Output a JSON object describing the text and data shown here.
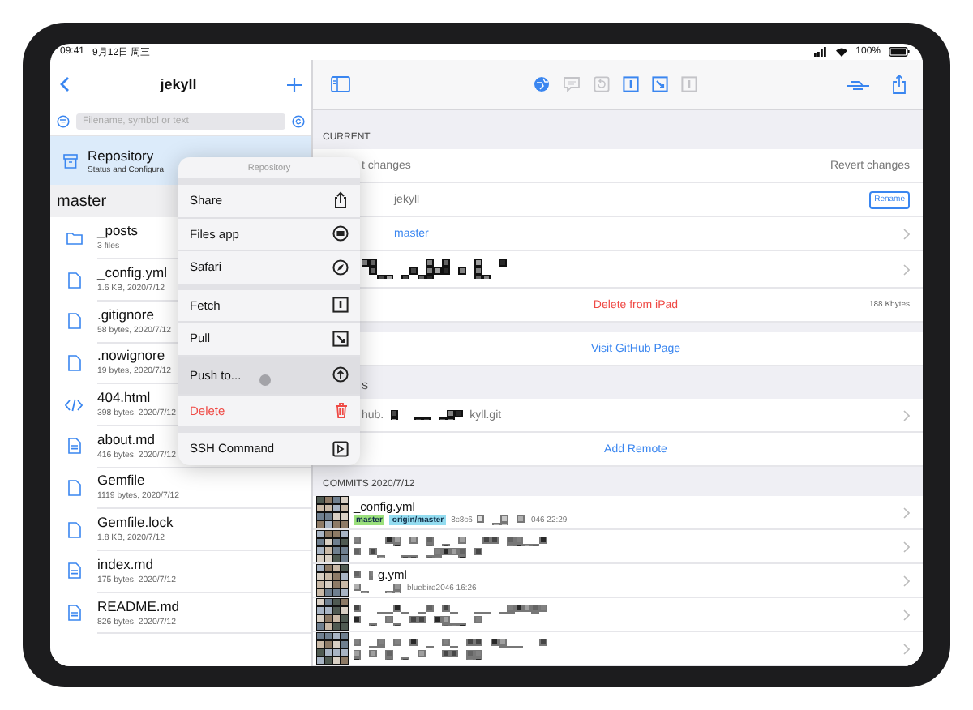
{
  "status_bar": {
    "time": "09:41",
    "date": "9月12日 周三",
    "battery": "100%"
  },
  "sidebar": {
    "title": "jekyll",
    "search": {
      "placeholder": "Filename, symbol or text"
    },
    "repository": {
      "title": "Repository",
      "subtitle": "Status and Configura",
      "selected": true
    },
    "branch": "master",
    "files": [
      {
        "name": "_posts",
        "detail": "3 files",
        "kind": "folder"
      },
      {
        "name": "_config.yml",
        "detail": "1.6 KB, 2020/7/12",
        "kind": "file"
      },
      {
        "name": ".gitignore",
        "detail": "58 bytes, 2020/7/12",
        "kind": "file"
      },
      {
        "name": ".nowignore",
        "detail": "19 bytes, 2020/7/12",
        "kind": "file"
      },
      {
        "name": "404.html",
        "detail": "398 bytes, 2020/7/12",
        "kind": "code"
      },
      {
        "name": "about.md",
        "detail": "416 bytes, 2020/7/12",
        "kind": "text"
      },
      {
        "name": "Gemfile",
        "detail": "1119 bytes, 2020/7/12",
        "kind": "file"
      },
      {
        "name": "Gemfile.lock",
        "detail": "1.8 KB, 2020/7/12",
        "kind": "file"
      },
      {
        "name": "index.md",
        "detail": "175 bytes, 2020/7/12",
        "kind": "text"
      },
      {
        "name": "README.md",
        "detail": "826 bytes, 2020/7/12",
        "kind": "text"
      }
    ]
  },
  "toolbar": {
    "buttons": [
      {
        "kind": "globe",
        "disabled": false
      },
      {
        "kind": "comment",
        "disabled": true
      },
      {
        "kind": "revert",
        "disabled": true
      },
      {
        "kind": "fetch",
        "disabled": false
      },
      {
        "kind": "pull",
        "disabled": false
      },
      {
        "kind": "push",
        "disabled": true
      }
    ]
  },
  "details": {
    "current_header": "CURRENT",
    "changes": "t changes",
    "revert": "Revert changes",
    "name": "jekyll",
    "rename": "Rename",
    "branch": "master",
    "delete": "Delete from iPad",
    "size": "188 Kbytes",
    "visit": "Visit GitHub Page",
    "remotes_header": "S",
    "remote_start": "hub.",
    "remote_end": "kyll.git",
    "add_remote": "Add Remote"
  },
  "commits": {
    "header": "COMMITS 2020/7/12",
    "rows": [
      {
        "title": "_config.yml",
        "tags": [
          {
            "label": "master",
            "color": "#9be07c"
          },
          {
            "label": "origin/master",
            "color": "#93dcf0"
          }
        ],
        "hash": "8c8c6",
        "meta": "046 22:29"
      },
      {},
      {
        "title": "g.yml",
        "meta": "bluebird2046 16:26"
      },
      {},
      {}
    ]
  },
  "menu": {
    "title": "Repository",
    "groups": [
      [
        {
          "label": "Share",
          "kind": "normal",
          "selected": false
        },
        {
          "label": "Files app",
          "kind": "normal",
          "selected": false
        },
        {
          "label": "Safari",
          "kind": "normal",
          "selected": false
        }
      ],
      [
        {
          "label": "Fetch",
          "kind": "normal",
          "selected": false
        },
        {
          "label": "Pull",
          "kind": "normal",
          "selected": false
        },
        {
          "label": "Push to...",
          "kind": "normal",
          "selected": true
        },
        {
          "label": "Delete",
          "kind": "destructive",
          "selected": false
        }
      ],
      [
        {
          "label": "SSH Command",
          "kind": "normal",
          "selected": false
        }
      ]
    ]
  }
}
